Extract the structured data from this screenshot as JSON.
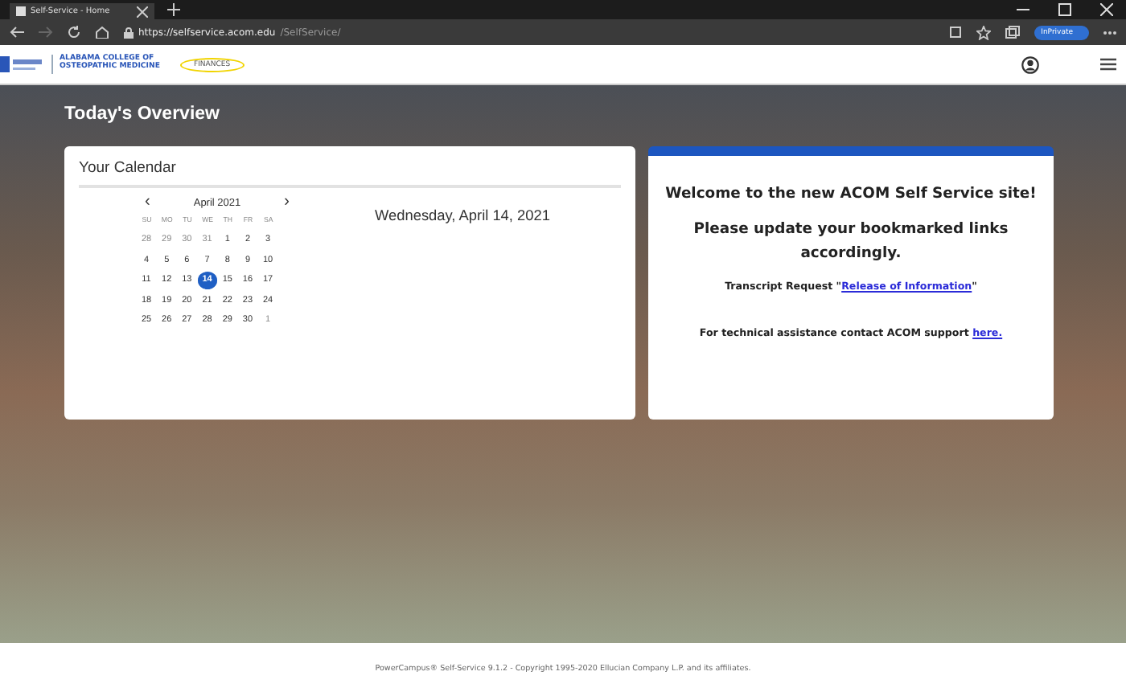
{
  "browser": {
    "tab_title": "Self-Service - Home",
    "url_host": "https://selfservice.acom.edu",
    "url_path": "/SelfService/",
    "profile_badge": "InPrivate"
  },
  "header": {
    "college_line_1": "ALABAMA COLLEGE OF",
    "college_line_2": "OSTEOPATHIC MEDICINE",
    "nav_item": "FINANCES"
  },
  "page_title": "Today's Overview",
  "calendar": {
    "title": "Your Calendar",
    "month": "April 2021",
    "prev": "‹",
    "next": "›",
    "selected_date": "Wednesday, April 14, 2021",
    "weekdays": [
      "SU",
      "MO",
      "TU",
      "WE",
      "TH",
      "FR",
      "SA"
    ],
    "weeks": [
      [
        {
          "label": "28",
          "muted": true,
          "selected": false
        },
        {
          "label": "29",
          "muted": true,
          "selected": false
        },
        {
          "label": "30",
          "muted": true,
          "selected": false
        },
        {
          "label": "31",
          "muted": true,
          "selected": false
        },
        {
          "label": "1",
          "muted": false,
          "selected": false
        },
        {
          "label": "2",
          "muted": false,
          "selected": false
        },
        {
          "label": "3",
          "muted": false,
          "selected": false
        }
      ],
      [
        {
          "label": "4",
          "muted": false,
          "selected": false
        },
        {
          "label": "5",
          "muted": false,
          "selected": false
        },
        {
          "label": "6",
          "muted": false,
          "selected": false
        },
        {
          "label": "7",
          "muted": false,
          "selected": false
        },
        {
          "label": "8",
          "muted": false,
          "selected": false
        },
        {
          "label": "9",
          "muted": false,
          "selected": false
        },
        {
          "label": "10",
          "muted": false,
          "selected": false
        }
      ],
      [
        {
          "label": "11",
          "muted": false,
          "selected": false
        },
        {
          "label": "12",
          "muted": false,
          "selected": false
        },
        {
          "label": "13",
          "muted": false,
          "selected": false
        },
        {
          "label": "14",
          "muted": false,
          "selected": true
        },
        {
          "label": "15",
          "muted": false,
          "selected": false
        },
        {
          "label": "16",
          "muted": false,
          "selected": false
        },
        {
          "label": "17",
          "muted": false,
          "selected": false
        }
      ],
      [
        {
          "label": "18",
          "muted": false,
          "selected": false
        },
        {
          "label": "19",
          "muted": false,
          "selected": false
        },
        {
          "label": "20",
          "muted": false,
          "selected": false
        },
        {
          "label": "21",
          "muted": false,
          "selected": false
        },
        {
          "label": "22",
          "muted": false,
          "selected": false
        },
        {
          "label": "23",
          "muted": false,
          "selected": false
        },
        {
          "label": "24",
          "muted": false,
          "selected": false
        }
      ],
      [
        {
          "label": "25",
          "muted": false,
          "selected": false
        },
        {
          "label": "26",
          "muted": false,
          "selected": false
        },
        {
          "label": "27",
          "muted": false,
          "selected": false
        },
        {
          "label": "28",
          "muted": false,
          "selected": false
        },
        {
          "label": "29",
          "muted": false,
          "selected": false
        },
        {
          "label": "30",
          "muted": false,
          "selected": false
        },
        {
          "label": "1",
          "muted": true,
          "selected": false
        }
      ]
    ]
  },
  "welcome": {
    "heading": "Welcome to the new ACOM Self Service site!",
    "subheading": "Please update your bookmarked links accordingly.",
    "transcript": {
      "before": "Transcript Request \"",
      "link": "Release of Information",
      "after": "\""
    },
    "support": {
      "before": "For technical assistance contact ACOM support ",
      "link": "here."
    }
  },
  "footer": "PowerCampus® Self-Service 9.1.2 - Copyright 1995-2020 Ellucian Company L.P. and its affiliates."
}
